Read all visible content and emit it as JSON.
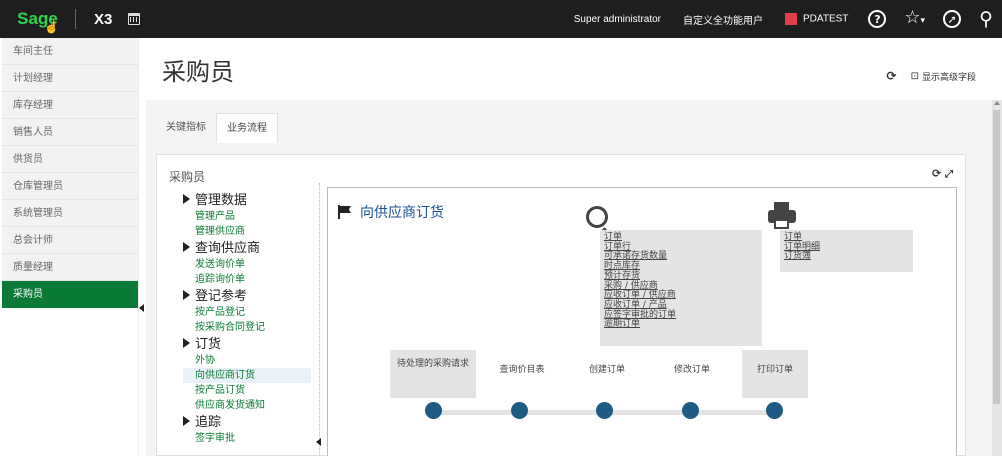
{
  "topbar": {
    "logo": "Sage",
    "product": "X3",
    "user": "Super administrator",
    "role": "自定义全功能用户",
    "folder": "PDATEST",
    "folder_color": "#e0404a"
  },
  "sidebar": {
    "items": [
      {
        "label": "车间主任"
      },
      {
        "label": "计划经理"
      },
      {
        "label": "库存经理"
      },
      {
        "label": "销售人员"
      },
      {
        "label": "供货员"
      },
      {
        "label": "仓库管理员"
      },
      {
        "label": "系统管理员"
      },
      {
        "label": "总会计师"
      },
      {
        "label": "质量经理"
      },
      {
        "label": "采购员"
      }
    ],
    "active_color": "#0b7a36"
  },
  "page": {
    "title": "采购员",
    "show_advanced": "显示高级字段"
  },
  "tabs": [
    {
      "label": "关键指标"
    },
    {
      "label": "业务流程"
    }
  ],
  "card": {
    "title": "采购员"
  },
  "tree": {
    "groups": [
      {
        "label": "管理数据",
        "links": [
          "管理产品",
          "管理供应商"
        ]
      },
      {
        "label": "查询供应商",
        "links": [
          "发送询价单",
          "追踪询价单"
        ]
      },
      {
        "label": "登记参考",
        "links": [
          "按产品登记",
          "按采购合同登记"
        ]
      },
      {
        "label": "订货",
        "links": [
          "外协",
          "向供应商订货",
          "按产品订货",
          "供应商发货通知"
        ]
      },
      {
        "label": "追踪",
        "links": [
          "签字审批"
        ]
      }
    ]
  },
  "flow": {
    "title": "向供应商订货",
    "inquiry_links": [
      "订单",
      "订单行",
      "可承诺存货数量",
      "时点库存",
      "预计存货",
      "采购 / 供应商",
      "应收订单 / 供应商",
      "应收订单 / 产品",
      "应签字审批的订单",
      "逾期订单"
    ],
    "print_links": [
      "订单",
      "订单明细",
      "订货簿"
    ],
    "steps": [
      {
        "label": "待处理的采购请求"
      },
      {
        "label": "查询价目表"
      },
      {
        "label": "创建订单"
      },
      {
        "label": "修改订单"
      },
      {
        "label": "打印订单"
      }
    ],
    "dot_color": "#1d5b84",
    "title_color": "#1a4f94"
  }
}
